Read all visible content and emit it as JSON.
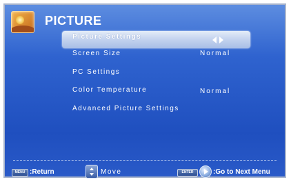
{
  "header": {
    "title": "PICTURE",
    "icon": "picture-icon"
  },
  "menu": {
    "items": [
      {
        "label": "Picture Settings",
        "value": "",
        "selected": true
      },
      {
        "label": "Screen Size",
        "value": "Normal",
        "selected": false
      },
      {
        "label": "PC Settings",
        "value": "",
        "selected": false
      },
      {
        "label": "Color Temperature",
        "value": "Normal",
        "selected": false
      },
      {
        "label": "Advanced Picture Settings",
        "value": "",
        "selected": false
      }
    ]
  },
  "footer": {
    "menu_key": "MENU",
    "return_label": ":Return",
    "move_label": "Move",
    "enter_key": "ENTER",
    "next_label": ":Go to Next Menu"
  },
  "colors": {
    "background": "#2f63cf",
    "highlight": "#c2d2ee",
    "text": "#ffffff"
  }
}
